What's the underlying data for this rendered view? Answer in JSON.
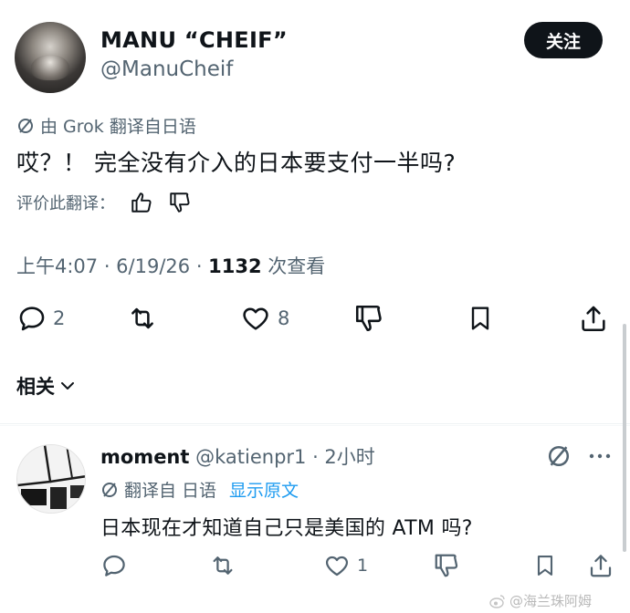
{
  "post": {
    "author_name": "MANU “CHEIF”",
    "author_handle": "@ManuCheif",
    "follow_label": "关注",
    "translation_note": "由 Grok 翻译自日语",
    "text": "哎？！ 完全没有介入的日本要支付一半吗?",
    "rate_label": "评价此翻译：",
    "time": "上午4:07 · 6/19/26 · ",
    "views": "1132",
    "views_label": " 次查看",
    "actions": {
      "reply_count": "2",
      "like_count": "8"
    }
  },
  "related": {
    "label": "相关"
  },
  "reply": {
    "author_name": "moment",
    "author_handle": "@katienpr1 · 2小时",
    "translation_note": "翻译自 日语",
    "show_original": "显示原文",
    "text": "日本现在才知道自己只是美国的 ATM 吗?",
    "actions": {
      "like_count": "1"
    }
  },
  "watermark": {
    "text": "@海兰珠阿姆"
  },
  "colors": {
    "text": "#0f1419",
    "secondary": "#536471",
    "link": "#1d9bf0",
    "button_bg": "#0f1419"
  }
}
